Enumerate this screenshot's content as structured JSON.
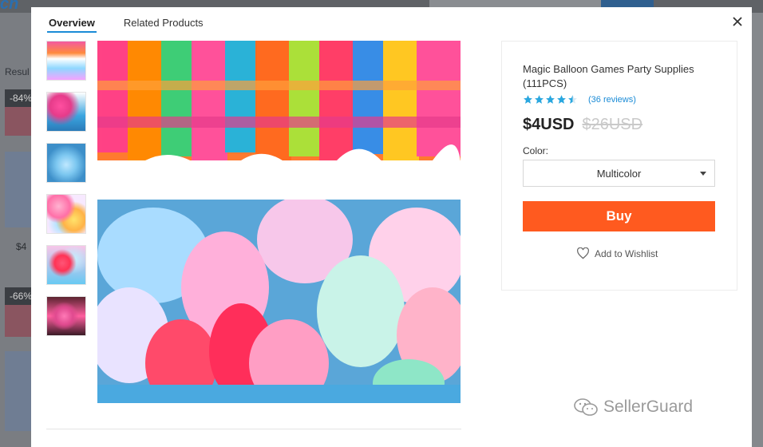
{
  "background": {
    "logo": "ch",
    "results_label": "Resul",
    "badges": [
      "-84%",
      "-66%"
    ],
    "price_fragment": "$4"
  },
  "tabs": [
    {
      "label": "Overview",
      "active": true
    },
    {
      "label": "Related Products",
      "active": false
    }
  ],
  "close_icon": "close-icon",
  "thumbnails": [
    {
      "alt": "balloon bundles"
    },
    {
      "alt": "pink balloons in bowl"
    },
    {
      "alt": "blue tub with balloons"
    },
    {
      "alt": "colorful balloons"
    },
    {
      "alt": "water balloons close-up"
    },
    {
      "alt": "balloons in box"
    }
  ],
  "product": {
    "title": "Magic Balloon Games Party Supplies (111PCS)",
    "rating": 4.5,
    "reviews": "(36 reviews)",
    "price": "$4USD",
    "original_price": "$26USD",
    "color_label": "Color:",
    "color_selected": "Multicolor",
    "buy_label": "Buy",
    "wishlist_label": "Add to Wishlist"
  },
  "watermark": "SellerGuard",
  "colors": {
    "accent": "#1a8bd6",
    "buy": "#ff5a1f",
    "star": "#2aa7df"
  }
}
